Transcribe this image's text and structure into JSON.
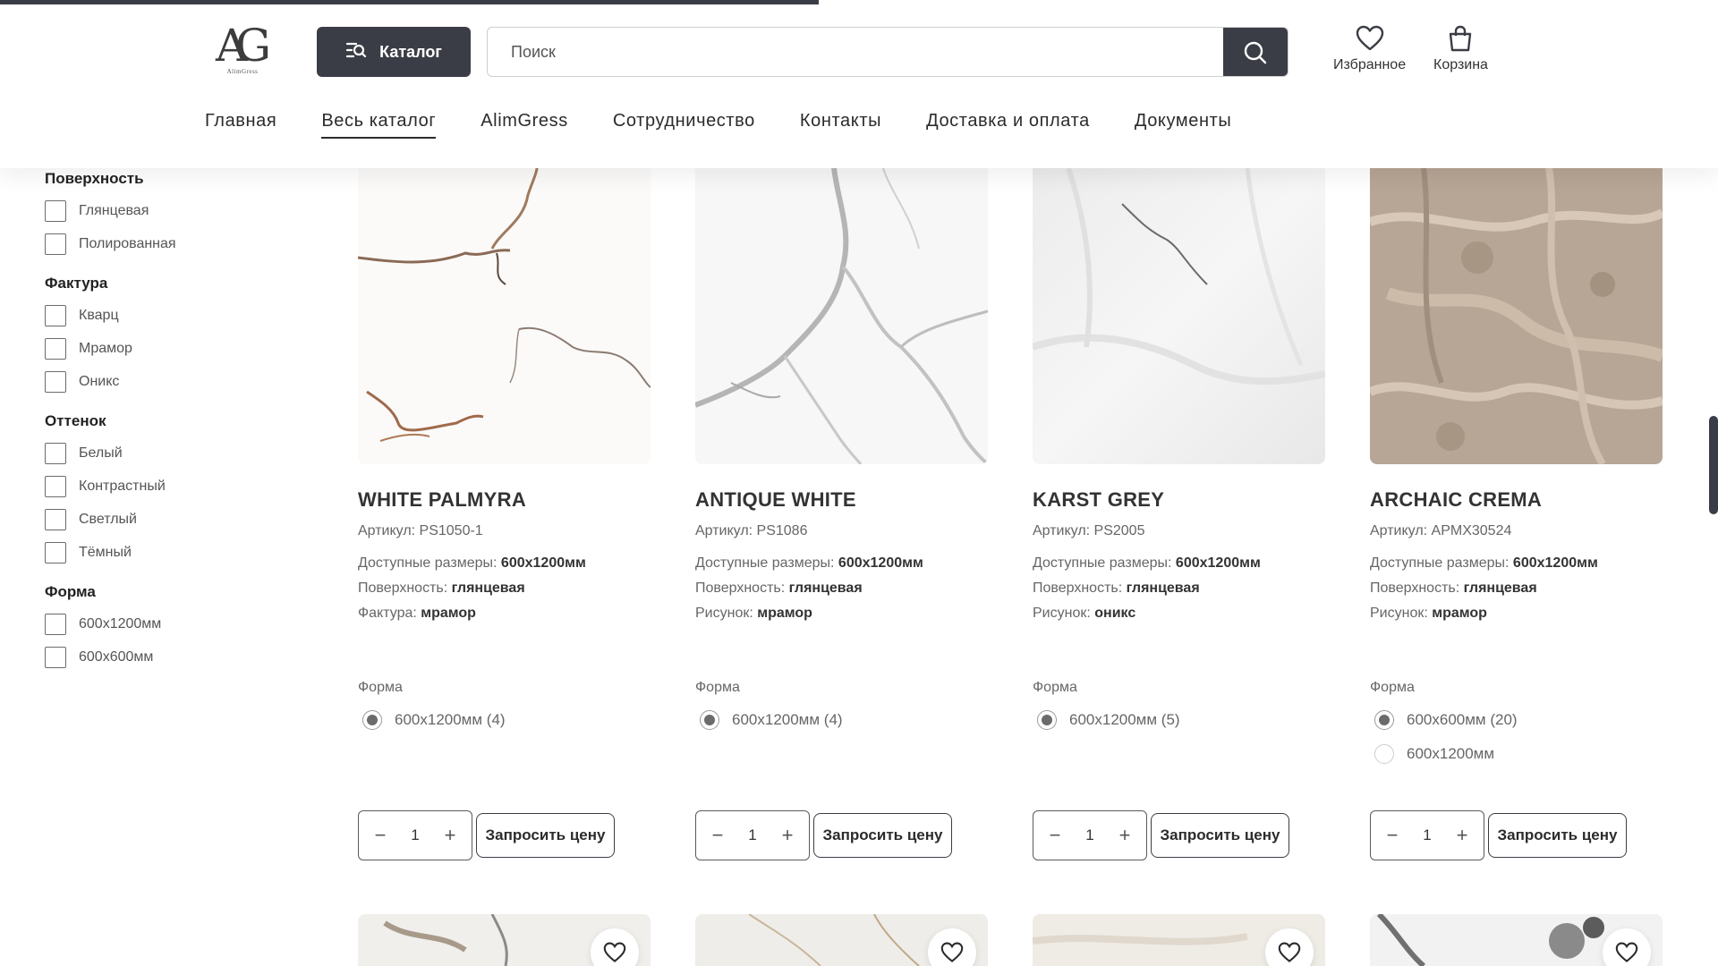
{
  "header": {
    "logo_text": "AlimGress",
    "logo_mark": "AG",
    "catalog_label": "Каталог",
    "search_placeholder": "Поиск",
    "favorites_label": "Избранное",
    "cart_label": "Корзина"
  },
  "nav": {
    "items": [
      "Главная",
      "Весь каталог",
      "AlimGress",
      "Сотрудничество",
      "Контакты",
      "Доставка и оплата",
      "Документы"
    ],
    "active": "Весь каталог"
  },
  "filters": {
    "groups": [
      {
        "title": "Поверхность",
        "options": [
          "Глянцевая",
          "Полированная"
        ]
      },
      {
        "title": "Фактура",
        "options": [
          "Кварц",
          "Мрамор",
          "Оникс"
        ]
      },
      {
        "title": "Оттенок",
        "options": [
          "Белый",
          "Контрастный",
          "Светлый",
          "Тёмный"
        ]
      },
      {
        "title": "Форма",
        "options": [
          "600x1200мм",
          "600x600мм"
        ]
      }
    ]
  },
  "products": [
    {
      "name": "WHITE PALMYRA",
      "sku": "Артикул: PS1050-1",
      "sizes_label": "Доступные размеры:",
      "sizes_value": "600x1200мм",
      "surface_label": "Поверхность:",
      "surface_value": "глянцевая",
      "third_label": "Фактура:",
      "third_value": "мрамор",
      "forma_label": "Форма",
      "forma_options": [
        "600x1200мм (4)"
      ],
      "qty": "1",
      "request_label": "Запросить цену"
    },
    {
      "name": "ANTIQUE WHITE",
      "sku": "Артикул: PS1086",
      "sizes_label": "Доступные размеры:",
      "sizes_value": "600x1200мм",
      "surface_label": "Поверхность:",
      "surface_value": "глянцевая",
      "third_label": "Рисунок:",
      "third_value": "мрамор",
      "forma_label": "Форма",
      "forma_options": [
        "600x1200мм (4)"
      ],
      "qty": "1",
      "request_label": "Запросить цену"
    },
    {
      "name": "KARST GREY",
      "sku": "Артикул: PS2005",
      "sizes_label": "Доступные размеры:",
      "sizes_value": "600x1200мм",
      "surface_label": "Поверхность:",
      "surface_value": "глянцевая",
      "third_label": "Рисунок:",
      "third_value": "оникс",
      "forma_label": "Форма",
      "forma_options": [
        "600x1200мм (5)"
      ],
      "qty": "1",
      "request_label": "Запросить цену"
    },
    {
      "name": "ARCHAIC CREMA",
      "sku": "Артикул: APMX30524",
      "sizes_label": "Доступные размеры:",
      "sizes_value": "600x1200мм",
      "surface_label": "Поверхность:",
      "surface_value": "глянцевая",
      "third_label": "Рисунок:",
      "third_value": "мрамор",
      "forma_label": "Форма",
      "forma_options": [
        "600x600мм (20)",
        "600x1200мм"
      ],
      "qty": "1",
      "request_label": "Запросить цену"
    }
  ],
  "colors": {
    "dark": "#3a3d45",
    "text": "#2b2b2b",
    "muted": "#666666"
  },
  "icons": {
    "catalog": "catalog-search-icon",
    "search": "search-icon",
    "favorites": "heart-icon",
    "cart": "shopping-bag-icon",
    "qty_minus": "minus-icon",
    "qty_plus": "plus-icon"
  }
}
